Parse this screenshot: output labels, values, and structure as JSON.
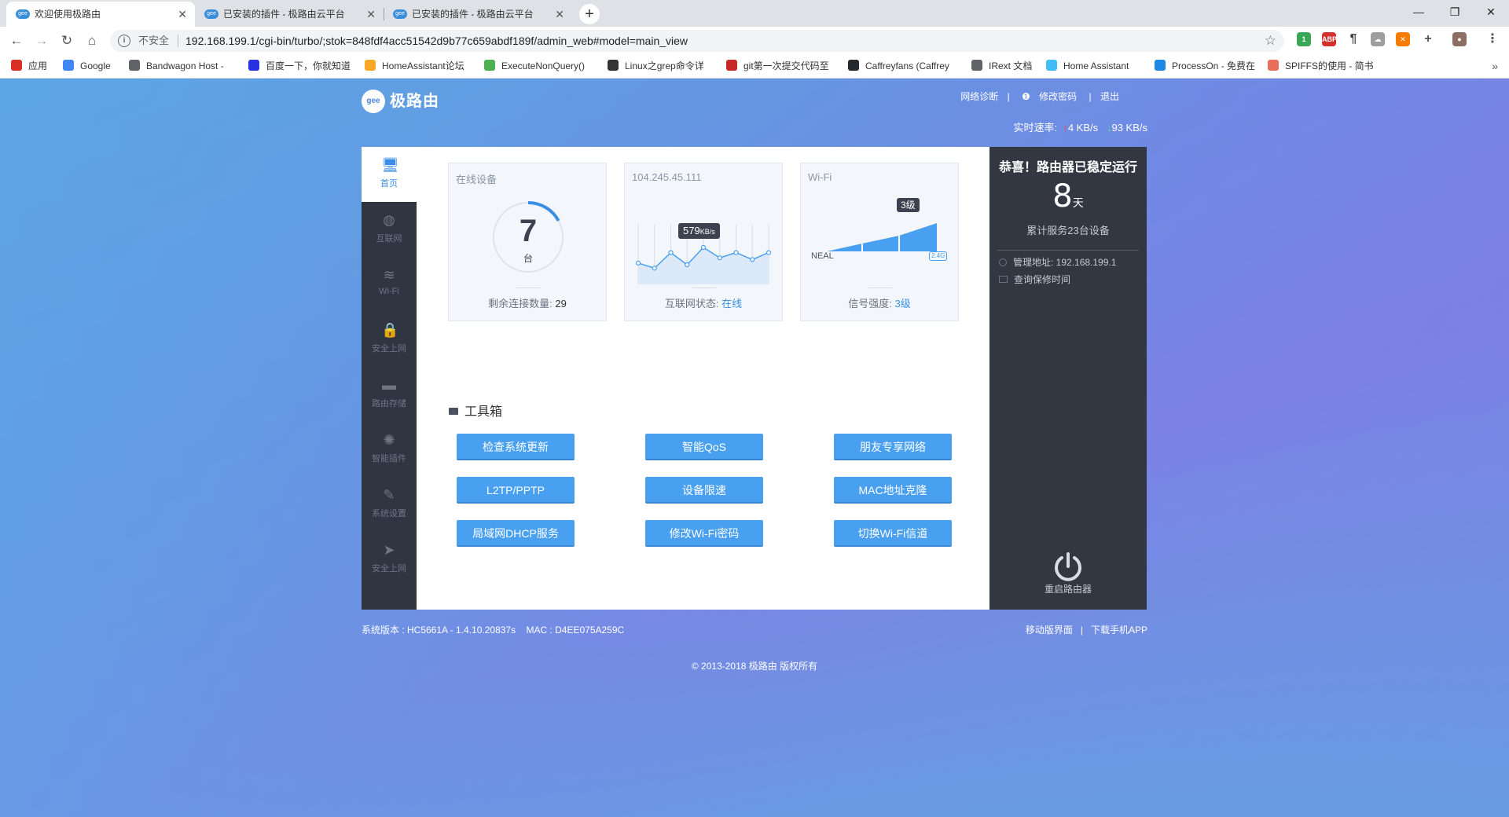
{
  "browser": {
    "tabs": [
      {
        "favicon": "gee",
        "title": "欢迎使用极路由"
      },
      {
        "favicon": "gee",
        "title": "已安装的插件 - 极路由云平台"
      },
      {
        "favicon": "gee",
        "title": "已安装的插件 - 极路由云平台"
      }
    ],
    "new_tab": "+",
    "window_controls": {
      "minimize": "—",
      "maximize": "❐",
      "close": "✕"
    },
    "nav": {
      "back": "←",
      "forward": "→",
      "reload": "↻",
      "home": "⌂"
    },
    "address": {
      "security_label": "不安全",
      "url": "192.168.199.1/cgi-bin/turbo/;stok=848fdf4acc51542d9b77c659abdf189f/admin_web#model=main_view",
      "star": "☆"
    },
    "extensions": [
      {
        "name": "green-ext-icon",
        "label": "1",
        "color": "#3aa757"
      },
      {
        "name": "abp-icon",
        "label": "ABP",
        "color": "#d32f2f"
      },
      {
        "name": "paragraph-icon",
        "label": "¶",
        "color": "#444444"
      },
      {
        "name": "cloud-icon",
        "label": "☁",
        "color": "#9e9e9e"
      },
      {
        "name": "orange-ext-icon",
        "label": "✕",
        "color": "#f57c00"
      },
      {
        "name": "plus-icon",
        "label": "+",
        "color": "#555555"
      },
      {
        "name": "avatar-icon",
        "label": "●",
        "color": "#8d6e63"
      },
      {
        "name": "menu-icon",
        "label": "⋮",
        "color": "#555555"
      }
    ],
    "bookmarks": [
      {
        "label": "应用",
        "color": "#d93025"
      },
      {
        "label": "Google",
        "color": "#4285f4"
      },
      {
        "label": "Bandwagon Host -",
        "color": "#5f6368"
      },
      {
        "label": "百度一下，你就知道",
        "color": "#2932e1"
      },
      {
        "label": "HomeAssistant论坛",
        "color": "#f9a825"
      },
      {
        "label": "ExecuteNonQuery()",
        "color": "#4caf50"
      },
      {
        "label": "Linux之grep命令详",
        "color": "#333333"
      },
      {
        "label": "git第一次提交代码至",
        "color": "#c62828"
      },
      {
        "label": "Caffreyfans (Caffrey",
        "color": "#24292e"
      },
      {
        "label": "IRext 文档",
        "color": "#5f6368"
      },
      {
        "label": "Home Assistant",
        "color": "#41bdf5"
      },
      {
        "label": "ProcessOn - 免费在",
        "color": "#1e88e5"
      },
      {
        "label": "SPIFFS的使用 - 简书",
        "color": "#ea6f5a"
      }
    ],
    "bookmarks_more": "»"
  },
  "header": {
    "logo_badge": "gee",
    "brand": "极路由",
    "links": [
      "网络诊断",
      "修改密码",
      "退出"
    ],
    "link_sep": "|",
    "password_icon": "❶",
    "speed_label": "实时速率:",
    "upload": "4 KB/s",
    "download": "93 KB/s",
    "up_arrow": "↑",
    "down_arrow": "↓"
  },
  "sidebar": {
    "items": [
      {
        "icon": "monitor-icon",
        "glyph": "🖥",
        "label": "首页",
        "active": true
      },
      {
        "icon": "globe-icon",
        "glyph": "◍",
        "label": "互联网"
      },
      {
        "icon": "wifi-icon",
        "glyph": "≋",
        "label": "Wi-Fi"
      },
      {
        "icon": "lock-icon",
        "glyph": "🔒",
        "label": "安全上网"
      },
      {
        "icon": "folder-icon",
        "glyph": "▬",
        "label": "路由存储"
      },
      {
        "icon": "bulb-icon",
        "glyph": "✺",
        "label": "智能插件"
      },
      {
        "icon": "wrench-icon",
        "glyph": "✎",
        "label": "系统设置"
      },
      {
        "icon": "plane-icon",
        "glyph": "➤",
        "label": "安全上网"
      }
    ]
  },
  "cards": {
    "devices": {
      "title": "在线设备",
      "count": "7",
      "unit": "台",
      "foot_label": "剩余连接数量:",
      "foot_value": "29",
      "ring_fraction": 0.17
    },
    "internet": {
      "title": "104.245.45.111",
      "speed_value": "579",
      "speed_unit": "KB/s",
      "foot_label": "互联网状态:",
      "foot_value": "在线",
      "sparkline": [
        6,
        3,
        12,
        5,
        15,
        9,
        12,
        8,
        12
      ]
    },
    "wifi": {
      "title": "Wi-Fi",
      "level_badge": "3级",
      "ssid": "NEAL",
      "band": "2.4G",
      "foot_label": "信号强度:",
      "foot_value": "3级"
    }
  },
  "toolbox": {
    "title": "工具箱",
    "buttons": [
      "检查系统更新",
      "智能QoS",
      "朋友专享网络",
      "L2TP/PPTP",
      "设备限速",
      "MAC地址克隆",
      "局域网DHCP服务",
      "修改Wi-Fi密码",
      "切换Wi-Fi信道"
    ]
  },
  "status_panel": {
    "congrats": "恭喜！路由器已稳定运行",
    "days": "8",
    "days_unit": "天",
    "served": "累计服务23台设备",
    "admin_addr": "管理地址: 192.168.199.1",
    "warranty": "查询保修时间",
    "reboot": "重启路由器"
  },
  "footer": {
    "version": "系统版本 : HC5661A - 1.4.10.20837s",
    "mac": "MAC : D4EE075A259C",
    "mobile": "移动版界面",
    "sep": "|",
    "download_app": "下载手机APP",
    "copyright": "© 2013-2018 极路由 版权所有"
  }
}
